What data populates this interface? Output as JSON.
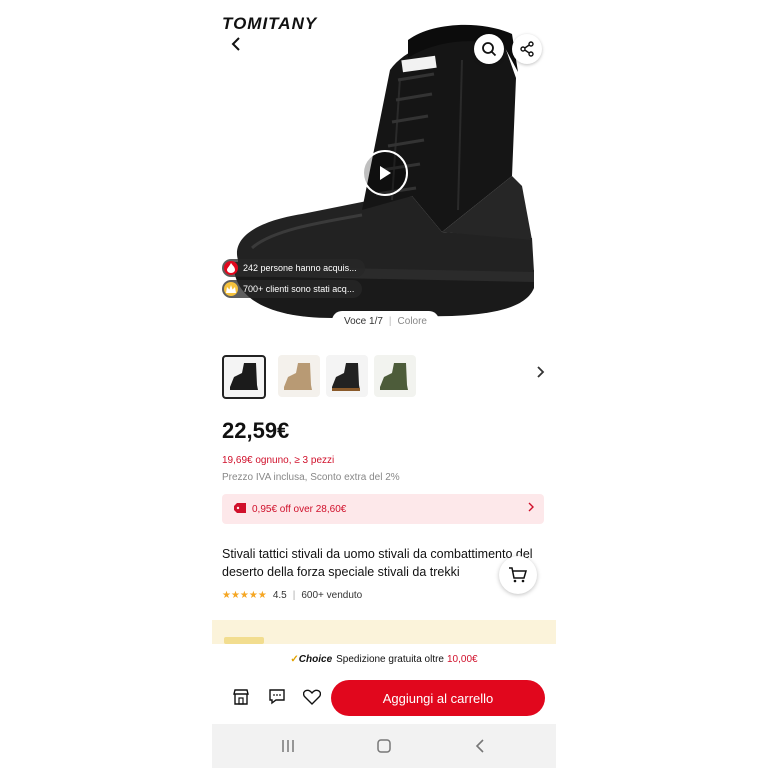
{
  "header": {
    "brand": "TOMITANY"
  },
  "hero": {
    "social_proof": [
      {
        "text": "242 persone hanno acquis...",
        "icon": "fire-icon"
      },
      {
        "text": "700+ clienti sono stati acq...",
        "icon": "crown-icon"
      }
    ],
    "counter": {
      "position": "Voce 1/7",
      "separator": "|",
      "mode": "Colore"
    }
  },
  "variants": {
    "thumbnails": [
      {
        "name": "black-boot-variant",
        "color": "#1b1b1b",
        "selected": true
      },
      {
        "name": "tan-boot-variant",
        "color": "#b89a74",
        "selected": false
      },
      {
        "name": "black-boot-alt-variant",
        "color": "#222222",
        "selected": false
      },
      {
        "name": "green-boot-variant",
        "color": "#4d5c3a",
        "selected": false
      }
    ]
  },
  "pricing": {
    "price": "22,59€",
    "bulk": "19,69€ ognuno, ≥ 3 pezzi",
    "vat_note": "Prezzo IVA inclusa, Sconto extra del 2%",
    "coupon": "0,95€ off over 28,60€"
  },
  "product": {
    "title": "Stivali tattici stivali da uomo stivali da combattimento del deserto della forza speciale stivali da trekki",
    "rating": "4.5",
    "rating_sep": "|",
    "sold": "600+ venduto"
  },
  "shipping": {
    "check": "✓",
    "choice": "Choice",
    "text": "Spedizione gratuita oltre",
    "threshold": "10,00€"
  },
  "actions": {
    "add_to_cart": "Aggiungi al carrello"
  },
  "colors": {
    "accent": "#e1071d",
    "sale_red": "#d0102b",
    "coupon_bg": "#fde8ea",
    "star": "#f5a623"
  }
}
